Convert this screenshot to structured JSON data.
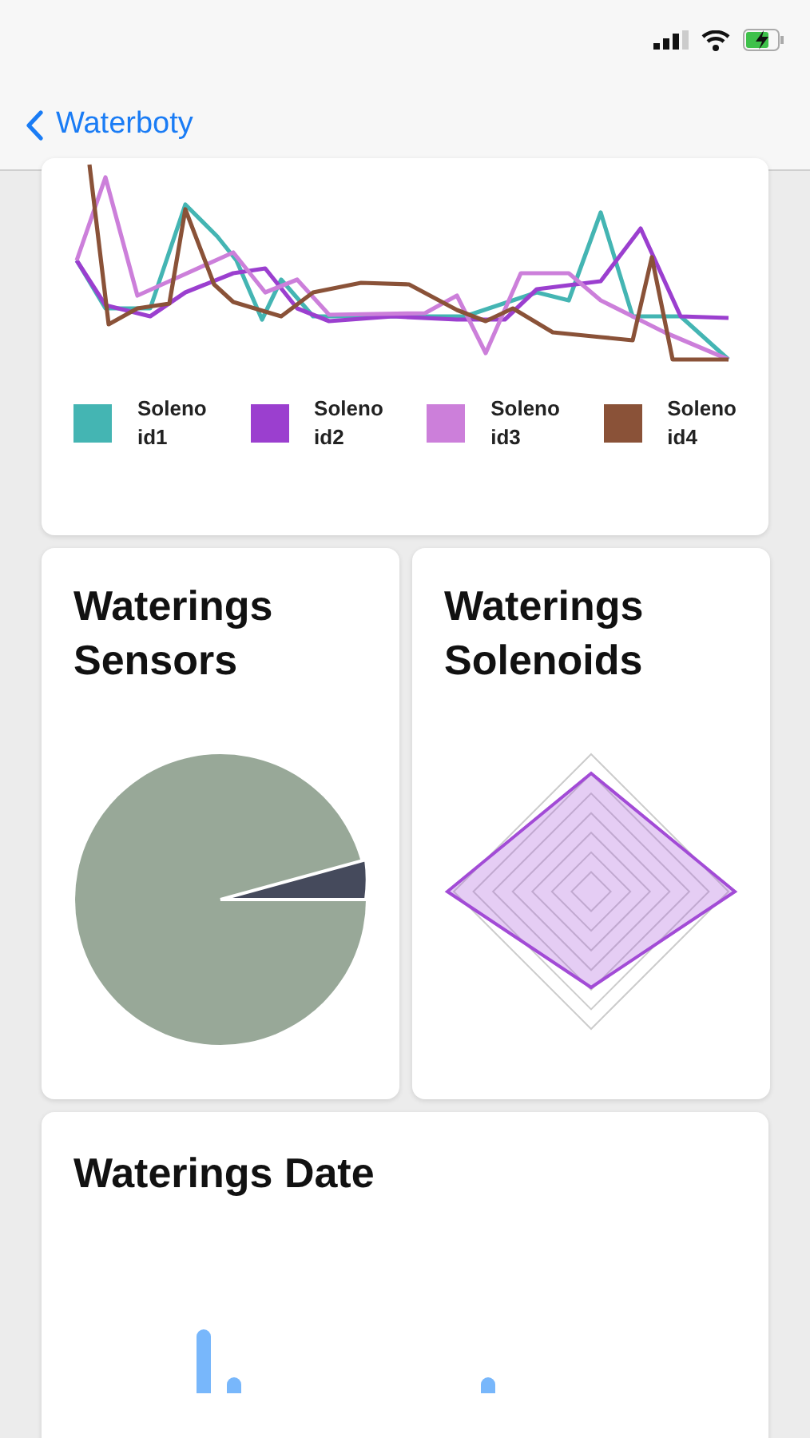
{
  "nav": {
    "back_label": "Waterboty"
  },
  "line_card": {
    "kind": "picture",
    "legend": [
      {
        "lines": [
          "Soleno",
          "id1"
        ],
        "color": "#44b5b3"
      },
      {
        "lines": [
          "Soleno",
          "id2"
        ],
        "color": "#9b3fcf"
      },
      {
        "lines": [
          "Soleno",
          "id3"
        ],
        "color": "#cc7fda"
      },
      {
        "lines": [
          "Soleno",
          "id4"
        ],
        "color": "#8a5238"
      }
    ]
  },
  "cards": [
    {
      "title": "Waterings Sensors",
      "kind": "pie"
    },
    {
      "title": "Waterings Solenoids",
      "kind": "radar"
    }
  ],
  "date_card": {
    "title": "Waterings Date",
    "kind": "bars"
  }
}
